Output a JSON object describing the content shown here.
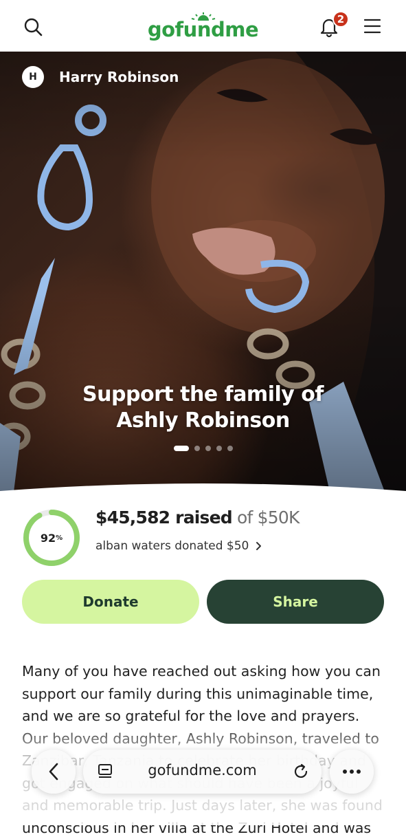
{
  "header": {
    "logo_text": "gofundme",
    "notification_count": "2",
    "brand_color": "#2f9e44",
    "icons": [
      "search-icon",
      "bell-icon",
      "menu-icon"
    ]
  },
  "hero": {
    "organizer_initial": "H",
    "organizer_name": "Harry Robinson",
    "title_line1": "Support the family of",
    "title_line2": "Ashly Robinson",
    "carousel_total": 5,
    "carousel_active": 1
  },
  "progress": {
    "percent_label": "92",
    "percent_sign": "%",
    "percent_value": 0.92,
    "raised_amount": "$45,582 raised",
    "goal_text": " of $50K",
    "recent_donation": "alban waters donated $50",
    "ring_color": "#8fd16a"
  },
  "actions": {
    "donate_label": "Donate",
    "share_label": "Share",
    "donate_color": "#d5f5a0",
    "share_color": "#274234"
  },
  "story": {
    "text": "Many of you have reached out asking how you can support our family during this unimaginable time, and we are so grateful for the love and prayers. Our beloved daughter, Ashly Robinson, traveled to Zanzibar, Tanzania to celebrate her birthday and got engaged on what should have been a joyful and memorable trip. Just days later, she was found unconscious in her villa at the Zuri Hotel and was"
  },
  "browser_bar": {
    "url": "gofundme.com",
    "icons": [
      "back-icon",
      "tabs-icon",
      "reload-icon",
      "more-icon"
    ]
  }
}
